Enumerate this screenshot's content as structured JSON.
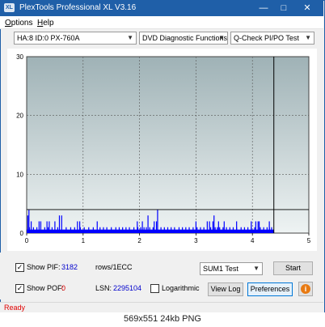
{
  "window": {
    "title": "PlexTools Professional XL V3.16",
    "icon_text": "XL",
    "minimize": "—",
    "maximize": "□",
    "close": "✕"
  },
  "menu": [
    {
      "pre": "",
      "ul": "O",
      "post": "ptions"
    },
    {
      "pre": "",
      "ul": "H",
      "post": "elp"
    }
  ],
  "toolbar": {
    "drive": "HA:8 ID:0  PX-760A",
    "function": "DVD Diagnostic Functions",
    "test": "Q-Check PI/PO Test"
  },
  "chart_data": {
    "type": "bar",
    "xlim": [
      0,
      5
    ],
    "ylim": [
      0,
      30
    ],
    "xticks": [
      "0",
      "1",
      "2",
      "3",
      "4",
      "5"
    ],
    "yticks": [
      "0",
      "10",
      "20",
      "30"
    ],
    "threshold_y": 4,
    "end_marker_x": 4.38,
    "series": [
      {
        "color": "#0000ff",
        "x": [
          0.02,
          0.05,
          0.08,
          0.12,
          0.18,
          0.25,
          0.32,
          0.38,
          0.45,
          0.5,
          0.55,
          0.62,
          0.7,
          0.78,
          0.85,
          0.9,
          0.95,
          1.02,
          1.1,
          1.18,
          1.25,
          1.3,
          1.36,
          1.42,
          1.5,
          1.58,
          1.64,
          1.7,
          1.76,
          1.82,
          1.9,
          1.97,
          2.02,
          2.08,
          2.12,
          2.18,
          2.24,
          2.3,
          2.38,
          2.44,
          2.5,
          2.56,
          2.62,
          2.7,
          2.76,
          2.82,
          2.88,
          2.95,
          3.02,
          3.08,
          3.14,
          3.2,
          3.26,
          3.3,
          3.34,
          3.38,
          3.42,
          3.48,
          3.54,
          3.6,
          3.66,
          3.72,
          3.8,
          3.86,
          3.92,
          3.98,
          4.04,
          4.1,
          4.14,
          4.2,
          4.26,
          4.3,
          4.34
        ],
        "values": [
          3,
          1,
          2,
          1,
          1,
          2,
          1,
          1,
          1,
          2,
          1,
          3,
          1,
          1,
          1,
          2,
          1,
          1,
          1,
          1,
          2,
          1,
          1,
          1,
          1,
          1,
          1,
          1,
          1,
          1,
          1,
          1,
          1,
          1,
          1,
          1,
          1,
          2,
          1,
          1,
          1,
          1,
          1,
          1,
          1,
          1,
          1,
          1,
          1,
          1,
          1,
          2,
          1,
          2,
          1,
          1,
          1,
          1,
          1,
          1,
          1,
          1,
          1,
          1,
          1,
          1,
          1,
          2,
          1,
          1,
          1,
          1,
          1
        ],
        "x_tall": [
          0.04,
          0.22,
          0.36,
          0.4,
          0.58,
          0.94,
          1.96,
          2.05,
          2.15,
          2.26,
          2.32,
          3.0,
          3.24,
          3.32,
          3.4,
          3.5,
          3.72,
          3.98,
          4.06,
          4.12,
          4.3
        ],
        "values_tall": [
          4,
          2,
          2,
          2,
          3,
          2,
          2,
          2,
          3,
          2,
          4,
          2,
          2,
          3,
          2,
          2,
          2,
          2,
          2,
          2,
          2
        ]
      }
    ]
  },
  "controls": {
    "show_pif_label": "Show PIF:",
    "pif_value": "3182",
    "pif_unit": "rows/1ECC",
    "show_pof_label": "Show POF:",
    "pof_value": "0",
    "lsn_label": "LSN:",
    "lsn_value": "2295104",
    "logarithmic_label": "Logarithmic",
    "sum_select": "SUM1 Test",
    "start_button": "Start",
    "view_log_button": "View Log",
    "preferences_button": "Preferences",
    "check": "✓",
    "info": "i"
  },
  "status": {
    "text": "Ready"
  },
  "caption": "569x551  24kb  PNG",
  "colors": {
    "title_bar": "#1f5fa8",
    "status_text": "#e00000",
    "pif_value": "#0000cc",
    "pof_value": "#e00000",
    "plot_bg_top": "#9fb2b6",
    "plot_bg_bottom": "#eef3f3",
    "bars": "#0000ff"
  }
}
